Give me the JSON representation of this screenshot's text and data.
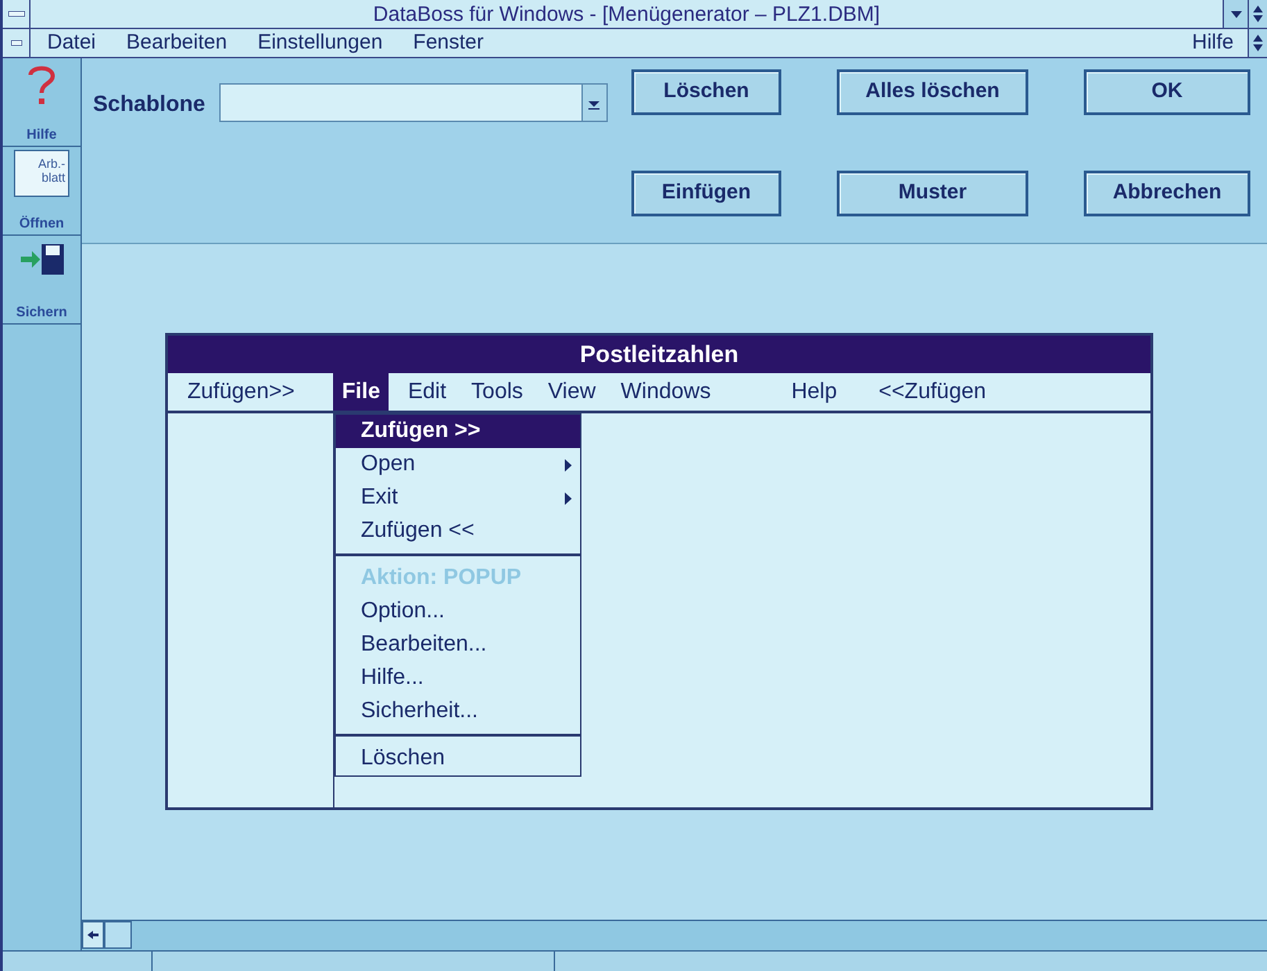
{
  "window": {
    "title": "DataBoss für Windows - [Menügenerator  –  PLZ1.DBM]"
  },
  "menu_bar": {
    "items": [
      "Datei",
      "Bearbeiten",
      "Einstellungen",
      "Fenster"
    ],
    "help": "Hilfe"
  },
  "toolbar": [
    {
      "kind": "help",
      "label": "Hilfe"
    },
    {
      "kind": "sheet",
      "label": "Öffnen",
      "icon_text": "Arb.-blatt"
    },
    {
      "kind": "save",
      "label": "Sichern"
    }
  ],
  "form": {
    "template_label": "Schablone",
    "buttons": [
      [
        "Löschen",
        "Alles löschen",
        "OK"
      ],
      [
        "Einfügen",
        "Muster",
        "Abbrechen"
      ]
    ]
  },
  "preview": {
    "title": "Postleitzahlen",
    "menu": [
      {
        "label": "Zufügen>>",
        "selected": false
      },
      {
        "label": "File",
        "selected": true
      },
      {
        "label": "Edit",
        "selected": false
      },
      {
        "label": "Tools",
        "selected": false
      },
      {
        "label": "View",
        "selected": false
      },
      {
        "label": "Windows",
        "selected": false
      },
      {
        "label": "Help",
        "selected": false
      },
      {
        "label": "<<Zufügen",
        "selected": false
      }
    ],
    "dropdown": [
      {
        "kind": "item",
        "label": "Zufügen >>",
        "selected": true,
        "disabled": false,
        "submenu": false
      },
      {
        "kind": "item",
        "label": "Open",
        "selected": false,
        "disabled": false,
        "submenu": true
      },
      {
        "kind": "item",
        "label": "Exit",
        "selected": false,
        "disabled": false,
        "submenu": true
      },
      {
        "kind": "item",
        "label": "Zufügen <<",
        "selected": false,
        "disabled": false,
        "submenu": false
      },
      {
        "kind": "separator"
      },
      {
        "kind": "item",
        "label": "Aktion: POPUP",
        "selected": false,
        "disabled": true,
        "submenu": false
      },
      {
        "kind": "item",
        "label": "Option...",
        "selected": false,
        "disabled": false,
        "submenu": false
      },
      {
        "kind": "item",
        "label": "Bearbeiten...",
        "selected": false,
        "disabled": false,
        "submenu": false
      },
      {
        "kind": "item",
        "label": "Hilfe...",
        "selected": false,
        "disabled": false,
        "submenu": false
      },
      {
        "kind": "item",
        "label": "Sicherheit...",
        "selected": false,
        "disabled": false,
        "submenu": false
      },
      {
        "kind": "separator"
      },
      {
        "kind": "item",
        "label": "Löschen",
        "selected": false,
        "disabled": false,
        "submenu": false
      }
    ]
  }
}
